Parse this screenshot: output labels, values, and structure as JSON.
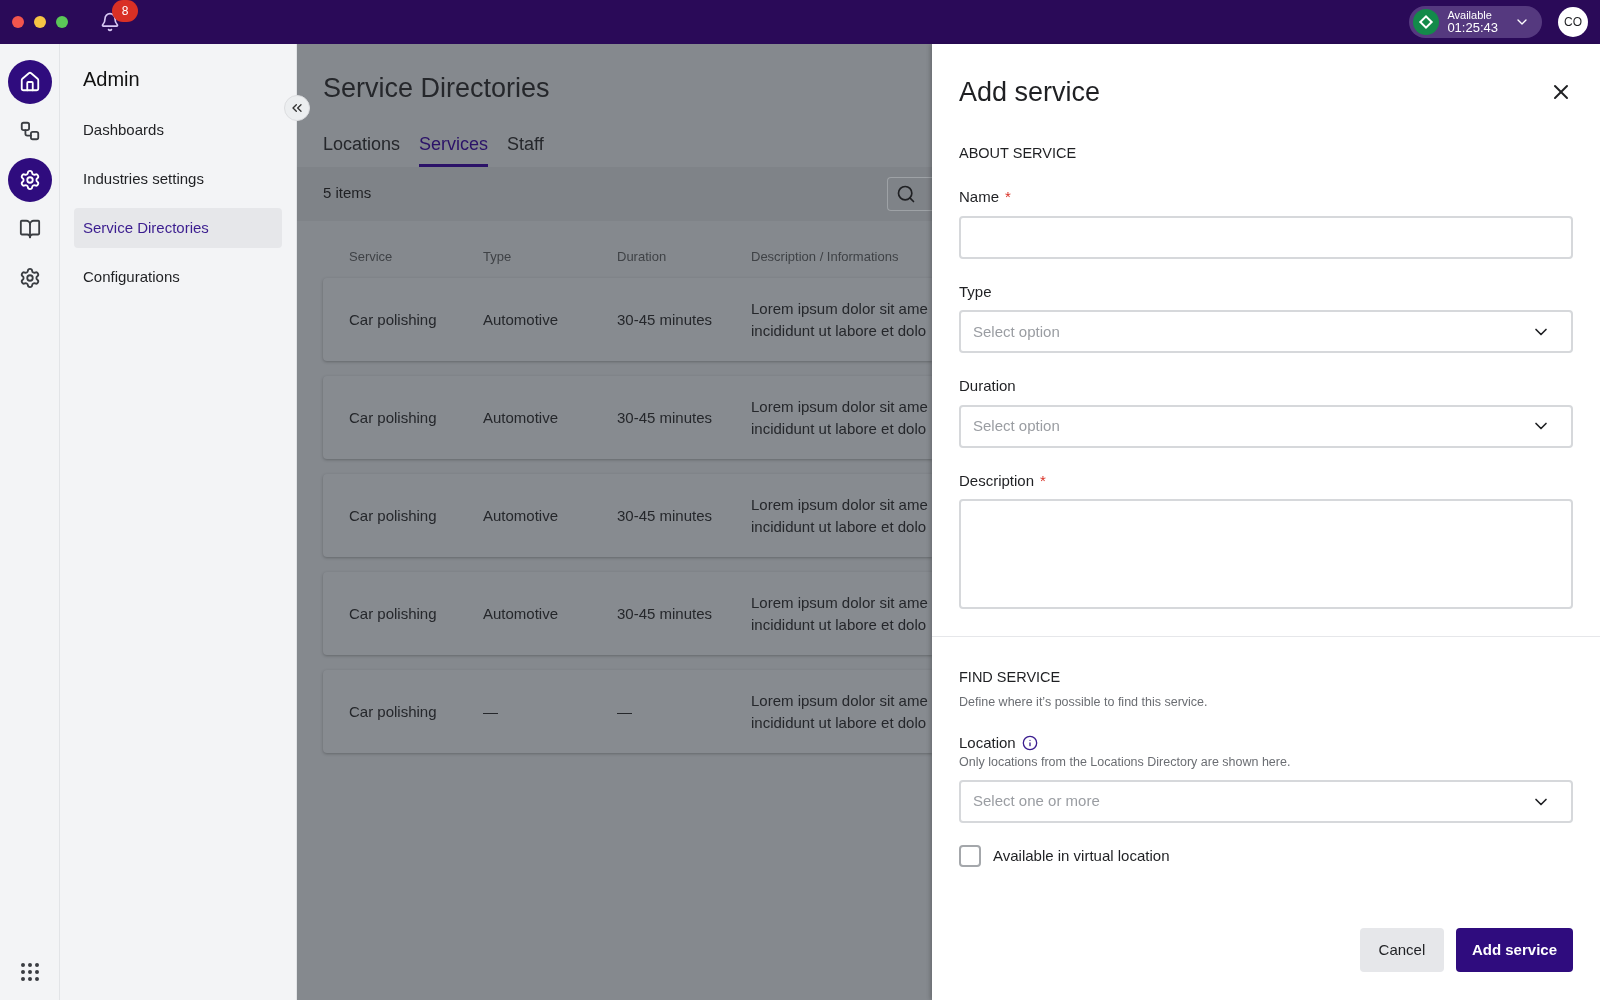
{
  "topbar": {
    "notifications": "8",
    "status": {
      "label": "Available",
      "time": "01:25:43"
    },
    "avatar": "CO"
  },
  "rail": [
    {
      "selected": true
    },
    {
      "selected": false
    },
    {
      "selected": true
    },
    {
      "selected": false
    },
    {
      "selected": false
    }
  ],
  "nav": {
    "title": "Admin",
    "items": [
      {
        "label": "Dashboards",
        "selected": false
      },
      {
        "label": "Industries settings",
        "selected": false
      },
      {
        "label": "Service Directories",
        "selected": true
      },
      {
        "label": "Configurations",
        "selected": false
      }
    ]
  },
  "page": {
    "title": "Service Directories",
    "tabs": [
      {
        "label": "Locations",
        "selected": false
      },
      {
        "label": "Services",
        "selected": true
      },
      {
        "label": "Staff",
        "selected": false
      }
    ],
    "count": "5 items",
    "table": {
      "columns": [
        "Service",
        "Type",
        "Duration",
        "Description / Informations"
      ],
      "rows": [
        [
          "Car polishing",
          "Automotive",
          "30-45 minutes",
          "Lorem ipsum dolor sit ame\nincididunt ut labore et dolo"
        ],
        [
          "Car polishing",
          "Automotive",
          "30-45 minutes",
          "Lorem ipsum dolor sit ame\nincididunt ut labore et dolo"
        ],
        [
          "Car polishing",
          "Automotive",
          "30-45 minutes",
          "Lorem ipsum dolor sit ame\nincididunt ut labore et dolo"
        ],
        [
          "Car polishing",
          "Automotive",
          "30-45 minutes",
          "Lorem ipsum dolor sit ame\nincididunt ut labore et dolo"
        ],
        [
          "Car polishing",
          "—",
          "—",
          "Lorem ipsum dolor sit ame\nincididunt ut labore et dolo"
        ]
      ]
    }
  },
  "drawer": {
    "title": "Add service",
    "sections": [
      {
        "heading": "ABOUT SERVICE",
        "fields": [
          {
            "kind": "text",
            "label": "Name",
            "required_mark": "*"
          },
          {
            "kind": "select",
            "label": "Type",
            "placeholder": "Select option"
          },
          {
            "kind": "select",
            "label": "Duration",
            "placeholder": "Select option"
          },
          {
            "kind": "textarea",
            "label": "Description",
            "required_mark": "*"
          }
        ]
      },
      {
        "heading": "FIND SERVICE",
        "subtitle": "Define where it’s possible to find this service.",
        "fields": [
          {
            "kind": "select",
            "label": "Location",
            "info": true,
            "hint": "Only locations from the Locations Directory are shown here.",
            "placeholder": "Select one or more"
          },
          {
            "kind": "checkbox",
            "label": "Available in virtual location",
            "checked": false
          }
        ]
      }
    ],
    "buttons": [
      {
        "label": "Cancel",
        "kind": "secondary"
      },
      {
        "label": "Add service",
        "kind": "primary"
      }
    ]
  }
}
